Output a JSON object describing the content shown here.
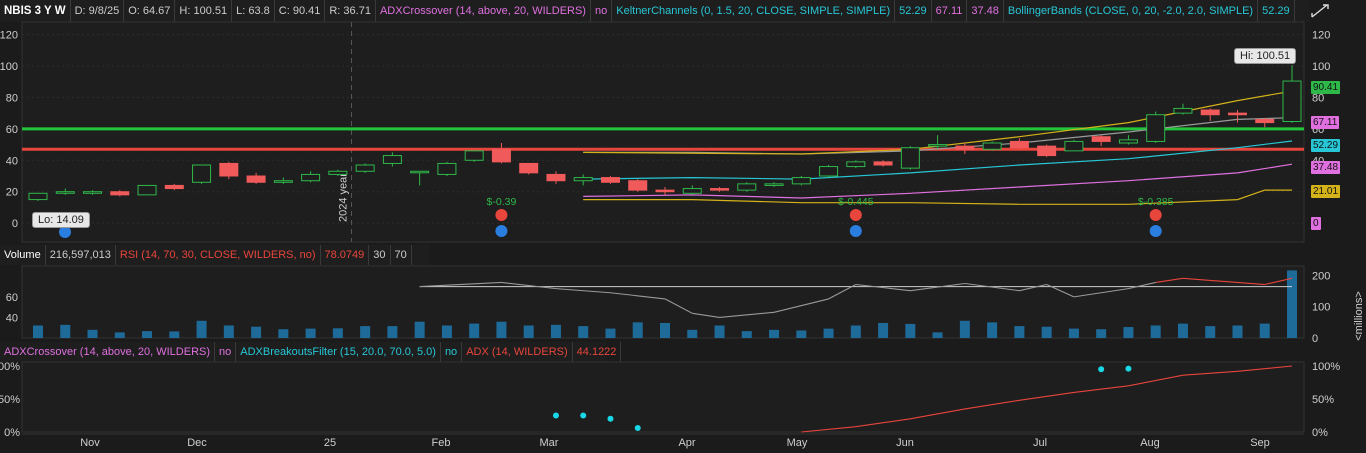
{
  "header": {
    "symbol": "NBIS 3 Y W",
    "date": "D: 9/8/25",
    "open": "O: 64.67",
    "high": "H: 100.51",
    "low": "L: 63.8",
    "close": "C: 90.41",
    "range": "R: 36.71",
    "adx_study": "ADXCrossover (14, above, 20, WILDERS)",
    "adx_value": "no",
    "keltner_study": "KeltnerChannels (0, 1.5, 20, CLOSE, SIMPLE, SIMPLE)",
    "keltner_values": [
      "52.29",
      "67.11",
      "37.48"
    ],
    "bollinger_study": "BollingerBands (CLOSE, 0, 20, -2.0, 2.0, SIMPLE)",
    "bollinger_value": "52.29"
  },
  "volume_header": {
    "label": "Volume",
    "value": "216,597,013",
    "rsi_study": "RSI (14, 70, 30, CLOSE, WILDERS, no)",
    "rsi_value": "78.0749",
    "rsi_levels": [
      "30",
      "70"
    ]
  },
  "lower_header": {
    "adx_crossover": "ADXCrossover (14, above, 20, WILDERS)",
    "adx_crossover_value": "no",
    "breakouts": "ADXBreakoutsFilter (15, 20.0, 70.0, 5.0)",
    "breakouts_value": "no",
    "adx": "ADX (14, WILDERS)",
    "adx_value": "44.1222"
  },
  "bubbles": {
    "high": "Hi: 100.51",
    "low": "Lo: 14.09"
  },
  "vertical_label": "2024 year",
  "earnings_labels": [
    "$-0.39",
    "$-0.445",
    "$-0.385"
  ],
  "right_tags": [
    {
      "text": "90.41",
      "color": "#2fb84a",
      "value": 90.41
    },
    {
      "text": "67.11",
      "color": "#e070e0",
      "value": 67.11
    },
    {
      "text": "52.29",
      "color": "#27c7d6",
      "value": 52.29
    },
    {
      "text": "37.48",
      "color": "#e070e0",
      "value": 37.48
    },
    {
      "text": "21.01",
      "color": "#d4b21a",
      "value": 21.01
    },
    {
      "text": "0",
      "color": "#e070e0",
      "value": 0
    }
  ],
  "volume_axis_unit": "<millions>",
  "colors": {
    "up": "#2fb84a",
    "down": "#f05a5a",
    "volume": "#1e6a99",
    "support": "#22c43a",
    "resistance": "#e8453c",
    "upper_band": "#d4b21a",
    "mid_band": "#27c7d6",
    "band": "#e070e0",
    "rsi": "#9a9a9a",
    "rsi_hot": "#e8453c",
    "adx": "#e8453c",
    "dots": "#18d8e8"
  },
  "chart_data": {
    "type": "candlestick",
    "x_labels": [
      "Nov",
      "Dec",
      "25",
      "Feb",
      "Mar",
      "Apr",
      "May",
      "Jun",
      "Jul",
      "Aug",
      "Sep"
    ],
    "price_axis": {
      "ticks": [
        0,
        20,
        40,
        60,
        80,
        100,
        120
      ],
      "ylim": [
        -12,
        128
      ]
    },
    "horizontal_lines": [
      60,
      47
    ],
    "candles": [
      {
        "o": 15,
        "h": 19,
        "l": 14.09,
        "c": 19
      },
      {
        "o": 19,
        "h": 22,
        "l": 18,
        "c": 20
      },
      {
        "o": 19,
        "h": 21,
        "l": 18,
        "c": 20
      },
      {
        "o": 20,
        "h": 21,
        "l": 17,
        "c": 18
      },
      {
        "o": 18,
        "h": 24,
        "l": 18,
        "c": 24
      },
      {
        "o": 24,
        "h": 25,
        "l": 21,
        "c": 22
      },
      {
        "o": 26,
        "h": 37,
        "l": 25,
        "c": 37
      },
      {
        "o": 38,
        "h": 39,
        "l": 28,
        "c": 30
      },
      {
        "o": 30,
        "h": 32,
        "l": 25,
        "c": 26
      },
      {
        "o": 26,
        "h": 29,
        "l": 25,
        "c": 27
      },
      {
        "o": 27,
        "h": 33,
        "l": 26,
        "c": 31
      },
      {
        "o": 31,
        "h": 34,
        "l": 30,
        "c": 33
      },
      {
        "o": 33,
        "h": 38,
        "l": 32,
        "c": 37
      },
      {
        "o": 38,
        "h": 45,
        "l": 36,
        "c": 43
      },
      {
        "o": 33,
        "h": 33,
        "l": 24,
        "c": 33
      },
      {
        "o": 31,
        "h": 39,
        "l": 30,
        "c": 38
      },
      {
        "o": 40,
        "h": 46,
        "l": 39,
        "c": 46
      },
      {
        "o": 47,
        "h": 51,
        "l": 38,
        "c": 39
      },
      {
        "o": 38,
        "h": 38,
        "l": 31,
        "c": 32
      },
      {
        "o": 31,
        "h": 33,
        "l": 25,
        "c": 27
      },
      {
        "o": 27,
        "h": 31,
        "l": 24,
        "c": 29
      },
      {
        "o": 29,
        "h": 30,
        "l": 25,
        "c": 26
      },
      {
        "o": 27,
        "h": 28,
        "l": 20,
        "c": 21
      },
      {
        "o": 21,
        "h": 23,
        "l": 18,
        "c": 20
      },
      {
        "o": 19,
        "h": 24,
        "l": 18,
        "c": 22
      },
      {
        "o": 22,
        "h": 23,
        "l": 20,
        "c": 21
      },
      {
        "o": 21,
        "h": 26,
        "l": 20,
        "c": 25
      },
      {
        "o": 24,
        "h": 26,
        "l": 23,
        "c": 25
      },
      {
        "o": 25,
        "h": 30,
        "l": 24,
        "c": 29
      },
      {
        "o": 30,
        "h": 37,
        "l": 29,
        "c": 36
      },
      {
        "o": 36,
        "h": 40,
        "l": 35,
        "c": 39
      },
      {
        "o": 39,
        "h": 40,
        "l": 36,
        "c": 37
      },
      {
        "o": 35,
        "h": 49,
        "l": 34,
        "c": 48
      },
      {
        "o": 49,
        "h": 56,
        "l": 47,
        "c": 50
      },
      {
        "o": 49,
        "h": 51,
        "l": 44,
        "c": 47
      },
      {
        "o": 47,
        "h": 52,
        "l": 46,
        "c": 51
      },
      {
        "o": 52,
        "h": 54,
        "l": 47,
        "c": 48
      },
      {
        "o": 49,
        "h": 50,
        "l": 42,
        "c": 43
      },
      {
        "o": 46,
        "h": 53,
        "l": 46,
        "c": 52
      },
      {
        "o": 55,
        "h": 56,
        "l": 49,
        "c": 52
      },
      {
        "o": 51,
        "h": 56,
        "l": 50,
        "c": 53
      },
      {
        "o": 52,
        "h": 71,
        "l": 51,
        "c": 69
      },
      {
        "o": 70,
        "h": 76,
        "l": 69,
        "c": 73
      },
      {
        "o": 72,
        "h": 73,
        "l": 65,
        "c": 69
      },
      {
        "o": 70,
        "h": 72,
        "l": 64,
        "c": 69
      },
      {
        "o": 66,
        "h": 67,
        "l": 61,
        "c": 64
      },
      {
        "o": 64.67,
        "h": 100.51,
        "l": 63.8,
        "c": 90.41
      }
    ],
    "bollinger_upper": [
      null,
      null,
      null,
      null,
      null,
      null,
      null,
      null,
      null,
      null,
      null,
      null,
      null,
      null,
      null,
      null,
      null,
      null,
      null,
      null,
      null,
      null,
      null,
      null,
      null,
      null,
      null,
      null,
      null,
      null,
      null,
      null,
      null,
      null,
      null,
      null,
      null,
      null,
      null,
      null,
      null,
      null,
      null,
      null,
      null,
      null,
      null
    ],
    "keltner_upper": [
      {
        "i": 20,
        "v": 45
      },
      {
        "i": 24,
        "v": 45
      },
      {
        "i": 28,
        "v": 44
      },
      {
        "i": 32,
        "v": 46
      },
      {
        "i": 36,
        "v": 51
      },
      {
        "i": 40,
        "v": 58
      },
      {
        "i": 44,
        "v": 66
      },
      {
        "i": 46,
        "v": 67.11
      }
    ],
    "keltner_mid": [
      {
        "i": 20,
        "v": 28
      },
      {
        "i": 24,
        "v": 29
      },
      {
        "i": 28,
        "v": 28
      },
      {
        "i": 32,
        "v": 32
      },
      {
        "i": 36,
        "v": 37
      },
      {
        "i": 40,
        "v": 41
      },
      {
        "i": 44,
        "v": 48
      },
      {
        "i": 46,
        "v": 52.29
      }
    ],
    "keltner_lower": [
      {
        "i": 20,
        "v": 17
      },
      {
        "i": 24,
        "v": 18
      },
      {
        "i": 28,
        "v": 16
      },
      {
        "i": 32,
        "v": 19
      },
      {
        "i": 36,
        "v": 23
      },
      {
        "i": 40,
        "v": 27
      },
      {
        "i": 44,
        "v": 32
      },
      {
        "i": 46,
        "v": 37.48
      }
    ],
    "bb_upper": [
      {
        "i": 20,
        "v": 45
      },
      {
        "i": 28,
        "v": 44
      },
      {
        "i": 32,
        "v": 47
      },
      {
        "i": 36,
        "v": 55
      },
      {
        "i": 40,
        "v": 64
      },
      {
        "i": 44,
        "v": 78
      },
      {
        "i": 46,
        "v": 84
      }
    ],
    "bb_lower": [
      {
        "i": 20,
        "v": 15
      },
      {
        "i": 24,
        "v": 15
      },
      {
        "i": 28,
        "v": 13
      },
      {
        "i": 32,
        "v": 13
      },
      {
        "i": 36,
        "v": 12
      },
      {
        "i": 40,
        "v": 12
      },
      {
        "i": 44,
        "v": 15
      },
      {
        "i": 45,
        "v": 21
      },
      {
        "i": 46,
        "v": 21.01
      }
    ],
    "earnings_at": [
      17,
      30,
      41
    ],
    "volume": {
      "ticks_left": [
        40,
        60
      ],
      "ticks_right": [
        100,
        200
      ],
      "values": [
        40,
        42,
        26,
        18,
        22,
        21,
        55,
        40,
        36,
        28,
        30,
        31,
        38,
        38,
        52,
        40,
        46,
        52,
        40,
        42,
        38,
        30,
        50,
        48,
        26,
        40,
        22,
        26,
        24,
        30,
        40,
        48,
        45,
        18,
        55,
        50,
        38,
        36,
        30,
        28,
        35,
        40,
        46,
        38,
        40,
        46,
        216
      ]
    },
    "rsi": [
      {
        "i": 14,
        "v": 70
      },
      {
        "i": 17,
        "v": 74
      },
      {
        "i": 19,
        "v": 68
      },
      {
        "i": 21,
        "v": 64
      },
      {
        "i": 23,
        "v": 58
      },
      {
        "i": 24,
        "v": 44
      },
      {
        "i": 25,
        "v": 40
      },
      {
        "i": 27,
        "v": 45
      },
      {
        "i": 29,
        "v": 58
      },
      {
        "i": 30,
        "v": 72
      },
      {
        "i": 32,
        "v": 66
      },
      {
        "i": 34,
        "v": 73
      },
      {
        "i": 36,
        "v": 66
      },
      {
        "i": 37,
        "v": 72
      },
      {
        "i": 38,
        "v": 60
      },
      {
        "i": 40,
        "v": 68
      },
      {
        "i": 41,
        "v": 74
      },
      {
        "i": 42,
        "v": 78
      },
      {
        "i": 43,
        "v": 76
      },
      {
        "i": 44,
        "v": 74
      },
      {
        "i": 45,
        "v": 72
      },
      {
        "i": 46,
        "v": 78
      }
    ],
    "adx_axis": {
      "ticks": [
        "0%",
        "50%",
        "100%"
      ]
    },
    "adx": [
      {
        "i": 28,
        "v": 0
      },
      {
        "i": 30,
        "v": 8
      },
      {
        "i": 32,
        "v": 20
      },
      {
        "i": 34,
        "v": 35
      },
      {
        "i": 36,
        "v": 48
      },
      {
        "i": 38,
        "v": 60
      },
      {
        "i": 40,
        "v": 70
      },
      {
        "i": 42,
        "v": 86
      },
      {
        "i": 44,
        "v": 92
      },
      {
        "i": 46,
        "v": 100
      }
    ],
    "adx_dots": [
      {
        "i": 19,
        "v": 25
      },
      {
        "i": 20,
        "v": 25
      },
      {
        "i": 21,
        "v": 20
      },
      {
        "i": 22,
        "v": 6
      },
      {
        "i": 39,
        "v": 95
      },
      {
        "i": 40,
        "v": 96
      }
    ]
  }
}
